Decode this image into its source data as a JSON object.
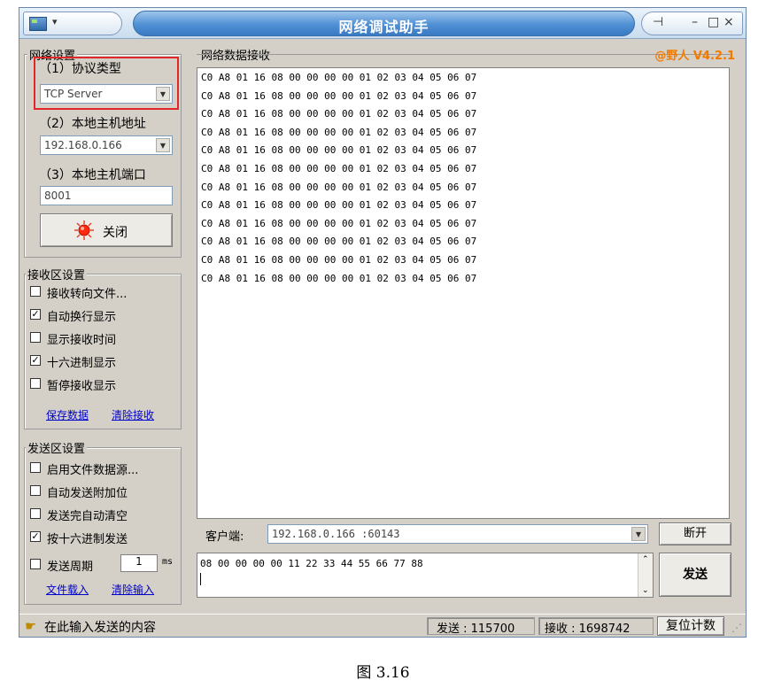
{
  "window": {
    "title": "网络调试助手",
    "version": "@野人 V4.2.1",
    "menu_arrow": "▾",
    "pin_glyph": "⊣",
    "min_glyph": "–",
    "max_glyph": "□",
    "close_glyph": "×"
  },
  "net_settings": {
    "group_label": "网络设置",
    "protocol_label": "（1）协议类型",
    "protocol_value": "TCP Server",
    "host_label": "（2）本地主机地址",
    "host_value": "192.168.0.166",
    "port_label": "（3）本地主机端口",
    "port_value": "8001",
    "close_button": "关闭"
  },
  "recv_settings": {
    "group_label": "接收区设置",
    "options": [
      {
        "label": "接收转向文件...",
        "checked": false
      },
      {
        "label": "自动换行显示",
        "checked": true
      },
      {
        "label": "显示接收时间",
        "checked": false
      },
      {
        "label": "十六进制显示",
        "checked": true
      },
      {
        "label": "暂停接收显示",
        "checked": false
      }
    ],
    "save_link": "保存数据",
    "clear_link": "清除接收"
  },
  "send_settings": {
    "group_label": "发送区设置",
    "options": [
      {
        "label": "启用文件数据源...",
        "checked": false
      },
      {
        "label": "自动发送附加位",
        "checked": false
      },
      {
        "label": "发送完自动清空",
        "checked": false
      },
      {
        "label": "按十六进制发送",
        "checked": true
      }
    ],
    "period_label": "发送周期",
    "period_value": "1",
    "period_unit": "ms",
    "load_link": "文件载入",
    "clear_link": "清除输入"
  },
  "recv_area": {
    "label": "网络数据接收",
    "lines": [
      "C0 A8 01 16 08 00 00 00 00 01 02 03 04 05 06 07",
      "C0 A8 01 16 08 00 00 00 00 01 02 03 04 05 06 07",
      "C0 A8 01 16 08 00 00 00 00 01 02 03 04 05 06 07",
      "C0 A8 01 16 08 00 00 00 00 01 02 03 04 05 06 07",
      "C0 A8 01 16 08 00 00 00 00 01 02 03 04 05 06 07",
      "C0 A8 01 16 08 00 00 00 00 01 02 03 04 05 06 07",
      "C0 A8 01 16 08 00 00 00 00 01 02 03 04 05 06 07",
      "C0 A8 01 16 08 00 00 00 00 01 02 03 04 05 06 07",
      "C0 A8 01 16 08 00 00 00 00 01 02 03 04 05 06 07",
      "C0 A8 01 16 08 00 00 00 00 01 02 03 04 05 06 07",
      "C0 A8 01 16 08 00 00 00 00 01 02 03 04 05 06 07",
      "C0 A8 01 16 08 00 00 00 00 01 02 03 04 05 06 07"
    ]
  },
  "client": {
    "label": "客户端:",
    "value": "192.168.0.166 :60143",
    "disconnect_button": "断开"
  },
  "send_area": {
    "text": "08 00 00 00 00 11 22 33 44 55 66 77 88",
    "send_button": "发送"
  },
  "status": {
    "hint": "在此输入发送的内容",
    "sent": "发送 : 115700",
    "received": "接收 : 1698742",
    "reset_button": "复位计数"
  },
  "caption": "图 3.16",
  "colors": {
    "highlight_box": "#e0282a",
    "version": "#f07a00",
    "link": "#0000cc"
  }
}
